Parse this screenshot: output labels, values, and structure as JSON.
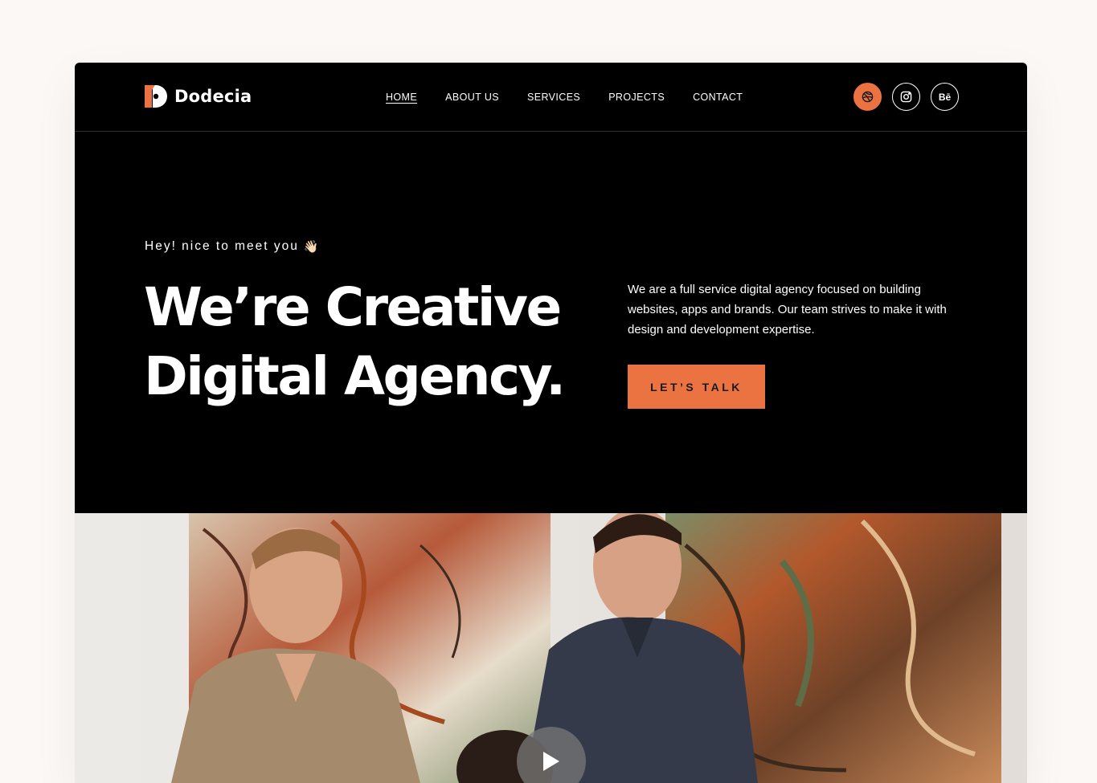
{
  "brand": {
    "name": "Dodecia",
    "accent_color": "#eb7341",
    "logo_icon": "dodecia-logo-icon"
  },
  "nav": {
    "items": [
      {
        "label": "HOME",
        "active": true
      },
      {
        "label": "ABOUT US",
        "active": false
      },
      {
        "label": "SERVICES",
        "active": false
      },
      {
        "label": "PROJECTS",
        "active": false
      },
      {
        "label": "CONTACT",
        "active": false
      }
    ]
  },
  "socials": [
    {
      "name": "dribbble-icon"
    },
    {
      "name": "instagram-icon"
    },
    {
      "name": "behance-icon",
      "text": "Bē"
    }
  ],
  "hero": {
    "greeting": "Hey! nice to meet you",
    "greeting_emoji": "👋🏻",
    "headline_line1": "We’re Creative",
    "headline_line2": "Digital Agency.",
    "description": "We are a full service digital agency focused on building websites, apps and brands. Our team strives to make it with design and development expertise.",
    "cta_label": "LET’S TALK"
  },
  "media": {
    "play_icon": "play-icon"
  }
}
